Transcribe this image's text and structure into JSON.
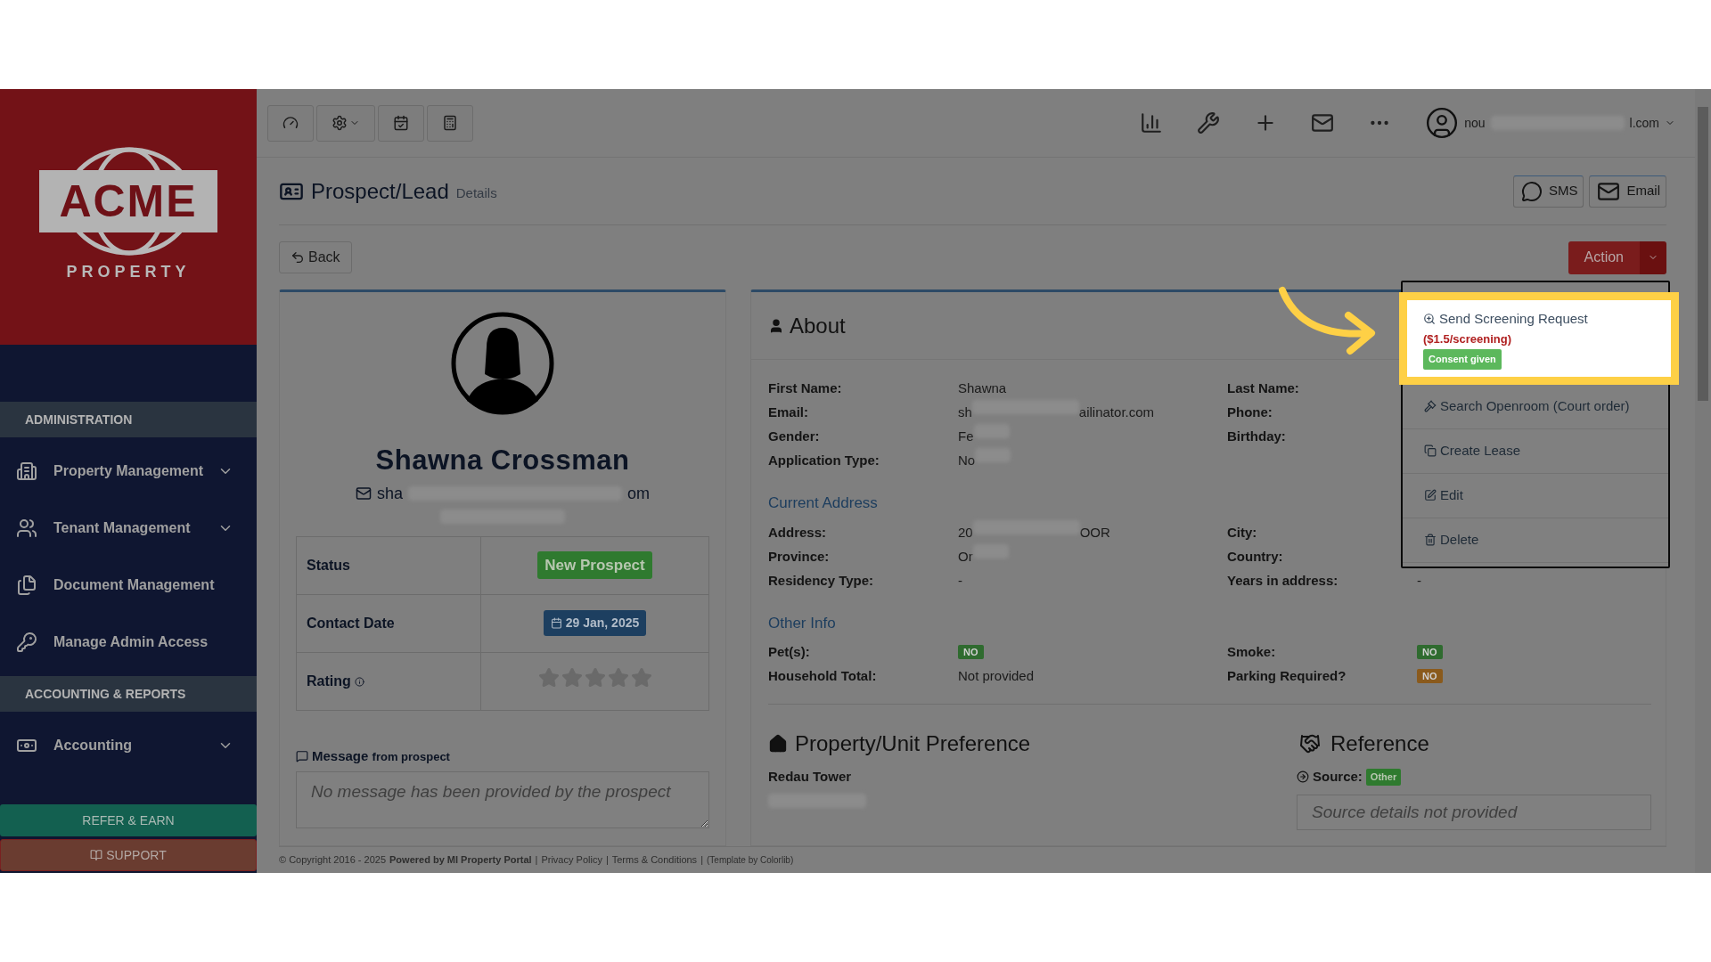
{
  "logo": {
    "name": "ACME",
    "tagline": "PROPERTY"
  },
  "sidebar": {
    "sections": [
      {
        "title": "ADMINISTRATION",
        "items": [
          {
            "label": "Property Management",
            "kind": "group"
          },
          {
            "label": "Tenant Management",
            "kind": "group"
          },
          {
            "label": "Document Management",
            "kind": "link"
          },
          {
            "label": "Manage Admin Access",
            "kind": "link"
          }
        ]
      },
      {
        "title": "ACCOUNTING & REPORTS",
        "items": [
          {
            "label": "Accounting",
            "kind": "group"
          }
        ]
      }
    ],
    "refer_button": "REFER & EARN",
    "support_button": "SUPPORT"
  },
  "toolbar": {
    "user_email_start": "nou",
    "user_email_end": "l.com"
  },
  "page": {
    "title": "Prospect/Lead",
    "subtitle": "Details",
    "sms_button": "SMS",
    "email_button": "Email",
    "back_button": "Back",
    "action_button": "Action"
  },
  "profile": {
    "name": "Shawna Crossman",
    "email_start": "sha",
    "email_end": "om",
    "rows": [
      {
        "label": "Status",
        "kind": "badge",
        "value": "New Prospect"
      },
      {
        "label": "Contact Date",
        "kind": "date",
        "value": "29 Jan, 2025"
      },
      {
        "label": "Rating",
        "kind": "stars",
        "stars": 0
      }
    ],
    "message_label": "Message",
    "message_label_rest": "from prospect",
    "message_placeholder": "No message has been provided by the prospect"
  },
  "about": {
    "title": "About",
    "fields": [
      {
        "label": "First Name:",
        "value": "Shawna"
      },
      {
        "label": "Last Name:"
      },
      {
        "label": "Email:",
        "value": "sh",
        "value_end": "ailinator.com"
      },
      {
        "label": "Phone:"
      },
      {
        "label": "Gender:",
        "value": "Fe"
      },
      {
        "label": "Birthday:"
      },
      {
        "label": "Application Type:",
        "value": "No"
      }
    ],
    "address_title": "Current Address",
    "address_fields": [
      {
        "label": "Address:",
        "value": "20",
        "value_end": "OOR"
      },
      {
        "label": "City:"
      },
      {
        "label": "Province:",
        "value": "Or"
      },
      {
        "label": "Country:"
      },
      {
        "label": "Residency Type:",
        "value": "-"
      },
      {
        "label": "Years in address:",
        "value": "-"
      }
    ],
    "other_title": "Other Info",
    "other_fields": [
      {
        "label": "Pet(s):",
        "badge": "NO",
        "color": "#2f6b2f"
      },
      {
        "label": "Smoke:",
        "badge": "NO",
        "color": "#2f6b2f"
      },
      {
        "label": "Household Total:",
        "value": "Not provided"
      },
      {
        "label": "Parking Required?",
        "badge": "NO",
        "color": "#8a5a1c"
      }
    ]
  },
  "preference": {
    "title": "Property/Unit Preference",
    "property": "Redau Tower"
  },
  "reference": {
    "title": "Reference",
    "source_label": "Source:",
    "source_badge": "Other",
    "source_placeholder": "Source details not provided"
  },
  "action_menu": {
    "items": [
      {
        "label": "Send Screening Request",
        "price": "($1.5/screening)",
        "badge": "Consent given",
        "highlighted": true
      },
      {
        "label": "Search Openroom (Court order)",
        "highlighted": false
      },
      {
        "label": "Create Lease",
        "highlighted": false
      },
      {
        "label": "Edit",
        "highlighted": false
      },
      {
        "label": "Delete",
        "highlighted": false
      }
    ]
  },
  "footer": {
    "parts": [
      {
        "text": "© Copyright 2016 - 2025",
        "kind": "plain"
      },
      {
        "text": "Powered by MI Property Portal",
        "kind": "bold"
      },
      {
        "text": "|",
        "kind": "separator"
      },
      {
        "text": "Privacy Policy",
        "kind": "link"
      },
      {
        "text": "|",
        "kind": "separator"
      },
      {
        "text": "Terms & Conditions",
        "kind": "link"
      },
      {
        "text": "|",
        "kind": "separator"
      },
      {
        "text": "(Template by Colorlib)",
        "kind": "small"
      }
    ]
  }
}
